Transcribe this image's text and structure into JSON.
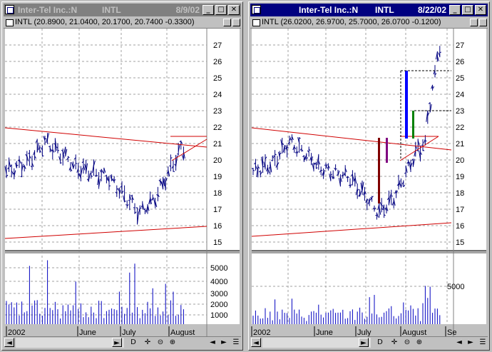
{
  "windows": [
    {
      "id": "left",
      "title": {
        "company": "Inter-Tel Inc.:N",
        "symbol": "INTL",
        "date": "8/9/02",
        "active": false
      },
      "pane_header": "INTL (20.8900, 21.0400, 20.1700, 20.7400 -0.3300)",
      "price_axis": [
        "27",
        "26",
        "25",
        "24",
        "23",
        "22",
        "21",
        "20",
        "19",
        "18",
        "17",
        "16",
        "15"
      ],
      "volume_axis": [
        "5000",
        "4000",
        "3000",
        "2000",
        "1000"
      ],
      "date_labels": [
        "2002",
        "June",
        "July",
        "August"
      ],
      "scroll_buttons": [
        "D",
        "✛",
        "⊝",
        "⊕",
        "◄",
        "►",
        "☰"
      ]
    },
    {
      "id": "right",
      "title": {
        "company": "Inter-Tel Inc.:N",
        "symbol": "INTL",
        "date": "8/22/02",
        "active": true
      },
      "pane_header": "INTL (26.0200, 26.9700, 25.7000, 26.0700 -0.1200)",
      "price_axis": [
        "27",
        "26",
        "25",
        "24",
        "23",
        "22",
        "21",
        "20",
        "19",
        "18",
        "17",
        "16",
        "15"
      ],
      "volume_axis": [
        "5000"
      ],
      "date_labels": [
        "2002",
        "June",
        "July",
        "August",
        "Se"
      ],
      "scroll_buttons": [
        "D",
        "✛",
        "⊝",
        "⊕",
        "◄",
        "►",
        "☰"
      ]
    }
  ],
  "colors": {
    "price_bars": "#000080",
    "volume_bars": "#0000c0",
    "trendline": "#d00000",
    "grid": "#a0a0a0",
    "dark_red": "#800000",
    "blue": "#0000ff",
    "green": "#008000",
    "purple": "#800080"
  }
}
